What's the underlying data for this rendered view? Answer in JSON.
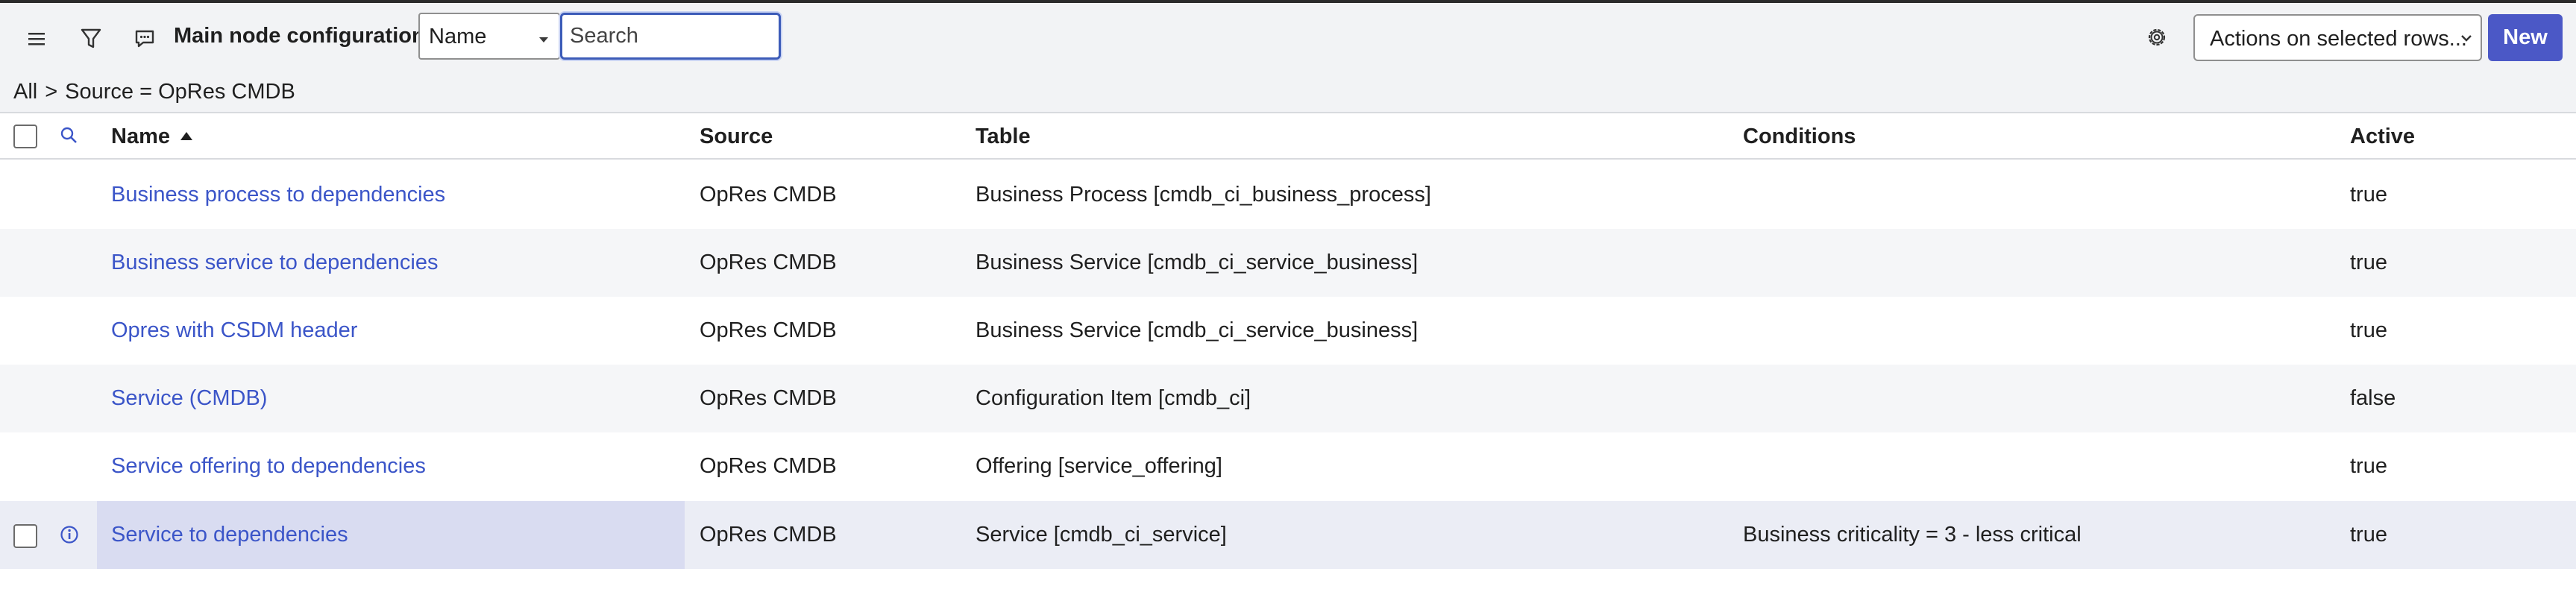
{
  "header": {
    "title": "Main node configurations",
    "field_select": "Name",
    "search_placeholder": "Search",
    "actions_select": "Actions on selected rows...",
    "new_button": "New"
  },
  "breadcrumb": {
    "all": "All",
    "separator": ">",
    "filter": "Source = OpRes CMDB"
  },
  "table": {
    "columns": [
      "Name",
      "Source",
      "Table",
      "Conditions",
      "Active"
    ],
    "sorted_column": "Name",
    "sort_direction": "ascending",
    "rows": [
      {
        "name": "Business process to dependencies",
        "source": "OpRes CMDB",
        "table": "Business Process [cmdb_ci_business_process]",
        "conditions": "",
        "active": "true"
      },
      {
        "name": "Business service to dependencies",
        "source": "OpRes CMDB",
        "table": "Business Service [cmdb_ci_service_business]",
        "conditions": "",
        "active": "true"
      },
      {
        "name": "Opres with CSDM header",
        "source": "OpRes CMDB",
        "table": "Business Service [cmdb_ci_service_business]",
        "conditions": "",
        "active": "true"
      },
      {
        "name": "Service (CMDB)",
        "source": "OpRes CMDB",
        "table": "Configuration Item [cmdb_ci]",
        "conditions": "",
        "active": "false"
      },
      {
        "name": "Service offering to dependencies",
        "source": "OpRes CMDB",
        "table": "Offering [service_offering]",
        "conditions": "",
        "active": "true"
      },
      {
        "name": "Service to dependencies",
        "source": "OpRes CMDB",
        "table": "Service [cmdb_ci_service]",
        "conditions": "Business criticality = 3 - less critical",
        "active": "true"
      }
    ]
  },
  "colors": {
    "link": "#3b55c8",
    "new_button": "#4b58c6",
    "search_focus": "#3c5bb8",
    "selected_row": "#ebedf5",
    "selected_name_cell": "#d9dcf1"
  },
  "icons": [
    "hamburger-menu-icon",
    "filter-icon",
    "comment-icon",
    "gear-icon",
    "column-search-icon",
    "info-icon",
    "chevron-down-icon"
  ]
}
